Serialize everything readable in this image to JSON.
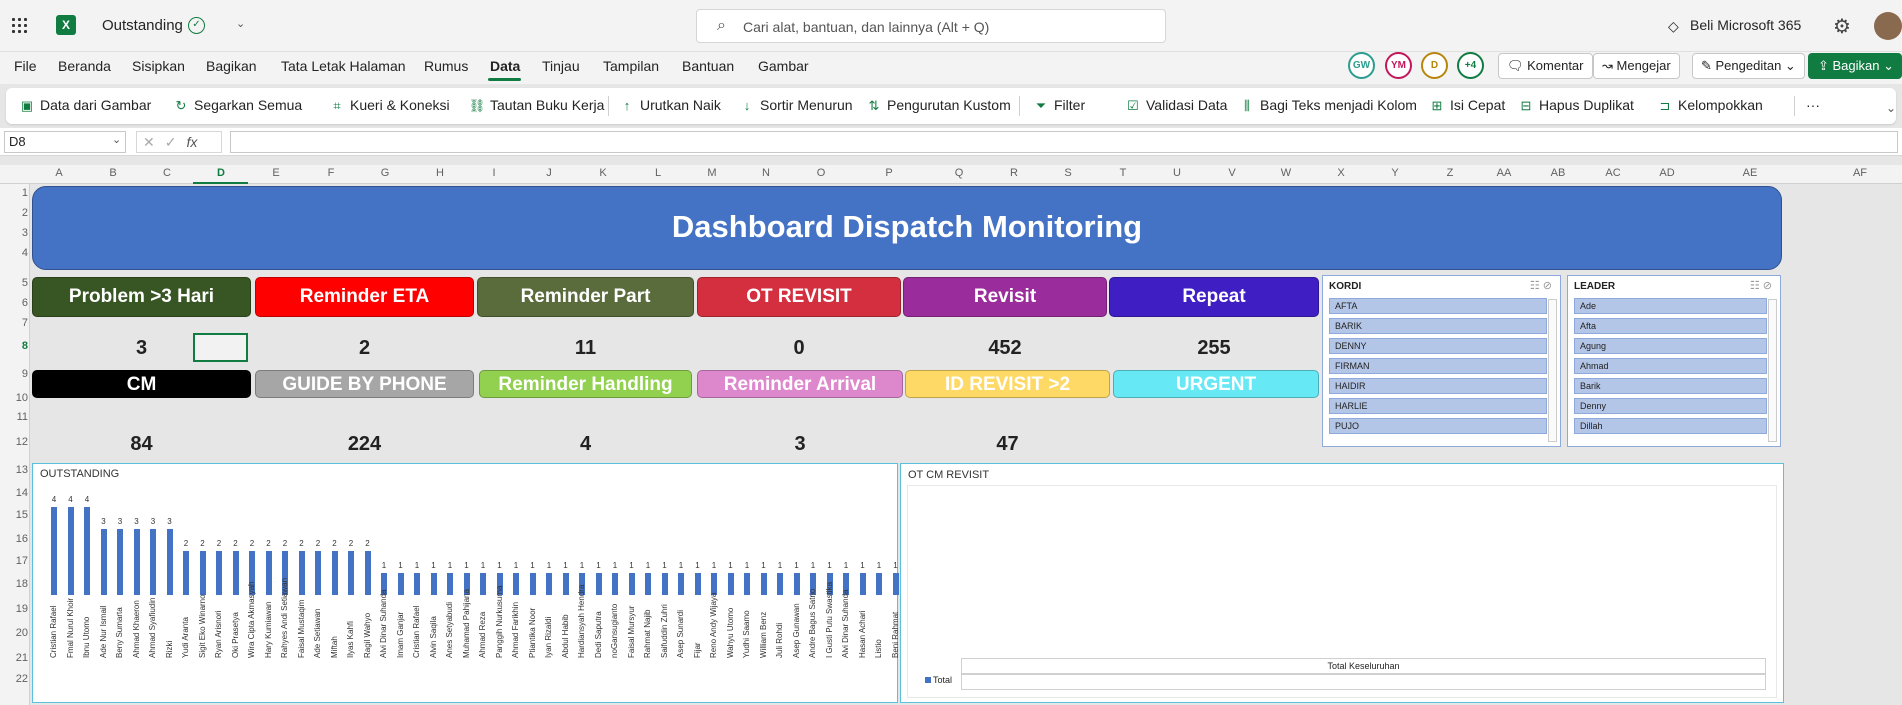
{
  "app": {
    "doc_name": "Outstanding",
    "search_placeholder": "Cari alat, bantuan, dan lainnya (Alt + Q)",
    "buy_label": "Beli Microsoft 365"
  },
  "menu": [
    "File",
    "Beranda",
    "Sisipkan",
    "Bagikan",
    "Tata Letak Halaman",
    "Rumus",
    "Data",
    "Tinjau",
    "Tampilan",
    "Bantuan",
    "Gambar"
  ],
  "menu_active": "Data",
  "collab": {
    "avatars": [
      {
        "initials": "GW",
        "color": "#2a9d8f"
      },
      {
        "initials": "YM",
        "color": "#c2185b"
      },
      {
        "initials": "D",
        "color": "#b8860b"
      }
    ],
    "more": "+4",
    "comment_label": "Komentar",
    "catchup_label": "Mengejar",
    "editing_label": "Pengeditan",
    "share_label": "Bagikan"
  },
  "ribbon": [
    "Data dari Gambar",
    "Segarkan Semua",
    "Kueri & Koneksi",
    "Tautan Buku Kerja",
    "Urutkan Naik",
    "Sortir Menurun",
    "Pengurutan Kustom",
    "Filter",
    "Validasi Data",
    "Bagi Teks menjadi Kolom",
    "Isi Cepat",
    "Hapus Duplikat",
    "Kelompokkan",
    "···"
  ],
  "formula_bar": {
    "name_box": "D8",
    "fx": "fx",
    "value": ""
  },
  "columns": [
    "A",
    "B",
    "C",
    "D",
    "E",
    "F",
    "G",
    "H",
    "I",
    "J",
    "K",
    "L",
    "M",
    "N",
    "O",
    "P",
    "Q",
    "R",
    "S",
    "T",
    "U",
    "V",
    "W",
    "X",
    "Y",
    "Z",
    "AA",
    "AB",
    "AC",
    "AD",
    "AE",
    "AF"
  ],
  "rows": [
    "1",
    "2",
    "3",
    "4",
    "5",
    "6",
    "7",
    "8",
    "9",
    "10",
    "11",
    "12",
    "13",
    "14",
    "15",
    "16",
    "17",
    "18",
    "19",
    "20",
    "21",
    "22"
  ],
  "dashboard": {
    "title": "Dashboard Dispatch Monitoring",
    "kpis_top": [
      {
        "label": "Problem >3 Hari",
        "value": "3",
        "color": "#375623"
      },
      {
        "label": "Reminder ETA",
        "value": "2",
        "color": "#ff0000"
      },
      {
        "label": "Reminder Part",
        "value": "11",
        "color": "#5a6b3c"
      },
      {
        "label": "OT REVISIT",
        "value": "0",
        "color": "#d32f3f"
      },
      {
        "label": "Revisit",
        "value": "452",
        "color": "#9b2c9b"
      },
      {
        "label": "Repeat",
        "value": "255",
        "color": "#3f1fc4"
      }
    ],
    "kpis_bottom": [
      {
        "label": "CM",
        "value": "84",
        "color": "#000000"
      },
      {
        "label": "GUIDE BY PHONE",
        "value": "224",
        "color": "#a6a6a6"
      },
      {
        "label": "Reminder Handling",
        "value": "4",
        "color": "#92d050"
      },
      {
        "label": "Reminder Arrival",
        "value": "3",
        "color": "#dd88cc"
      },
      {
        "label": "ID REVISIT >2",
        "value": "47",
        "color": "#ffd966"
      },
      {
        "label": "URGENT",
        "value": "",
        "color": "#66e8f5"
      }
    ]
  },
  "slicers": [
    {
      "title": "KORDI",
      "items": [
        "AFTA",
        "BARIK",
        "DENNY",
        "FIRMAN",
        "HAIDIR",
        "HARLIE",
        "PUJO"
      ]
    },
    {
      "title": "LEADER",
      "items": [
        "Ade",
        "Afta",
        "Agung",
        "Ahmad",
        "Barik",
        "Denny",
        "Dillah"
      ]
    }
  ],
  "chart_data": [
    {
      "type": "bar",
      "title": "OUTSTANDING",
      "categories": [
        "Cristian Rafael",
        "Fmal Nurul Khoir",
        "Ibnu Utomo",
        "Ade Nur Ismail",
        "Beny Sumarta",
        "Ahmad Khaeron",
        "Ahmad Syafiudin",
        "Rizki",
        "Yudi Aranta",
        "Sigit Eko Winarno",
        "Ryan Arisnori",
        "Oki Prasetya",
        "Wira Cipta Akmasyah",
        "Hary Kumiawan",
        "Rahyes Andi Setiawan",
        "Faisal Mustaqim",
        "Ade Setiawan",
        "Miftah",
        "Ilyas Kahfi",
        "Ragil Wahyo",
        "Alvi Dinar Suhanda",
        "Imam Ganjar",
        "Cristian Rafael",
        "Alvin Saqila",
        "Anes Setyabudi",
        "Muhamad Pahijana",
        "Ahmad Reza",
        "Panggih Nurkusuma",
        "Ahmad Farikhin",
        "Ptiantika Noor",
        "Iyan Rizaldi",
        "Abdul Habib",
        "Hardiansyah Hendra",
        "Dedi Saputra",
        "noGansugianto",
        "Faisal Mursyur",
        "Rahmat Najib",
        "Saifuddin Zuhri",
        "Asep Sunardi",
        "Fijar",
        "Reno Andy Wijaya",
        "Wahyu Utomo",
        "Yudhi Saamo",
        "William Benz",
        "Juli Rohdi",
        "Asep Gunawan",
        "Andre Bagus Satrio",
        "I Gusti Putu Swastika",
        "Alvi Dinar Suhanda",
        "Hasan Achari",
        "Listio",
        "Beni Rahmat"
      ],
      "values": [
        4,
        4,
        4,
        3,
        3,
        3,
        3,
        3,
        2,
        2,
        2,
        2,
        2,
        2,
        2,
        2,
        2,
        2,
        2,
        2,
        1,
        1,
        1,
        1,
        1,
        1,
        1,
        1,
        1,
        1,
        1,
        1,
        1,
        1,
        1,
        1,
        1,
        1,
        1,
        1,
        1,
        1,
        1,
        1,
        1,
        1,
        1,
        1,
        1,
        1,
        1,
        1
      ],
      "ylim": [
        0,
        4
      ]
    },
    {
      "type": "bar",
      "title": "OT CM REVISIT",
      "categories": [
        "Total Keseluruhan"
      ],
      "series": [
        {
          "name": "Total",
          "values": []
        }
      ],
      "legend": "bottom-left"
    }
  ]
}
